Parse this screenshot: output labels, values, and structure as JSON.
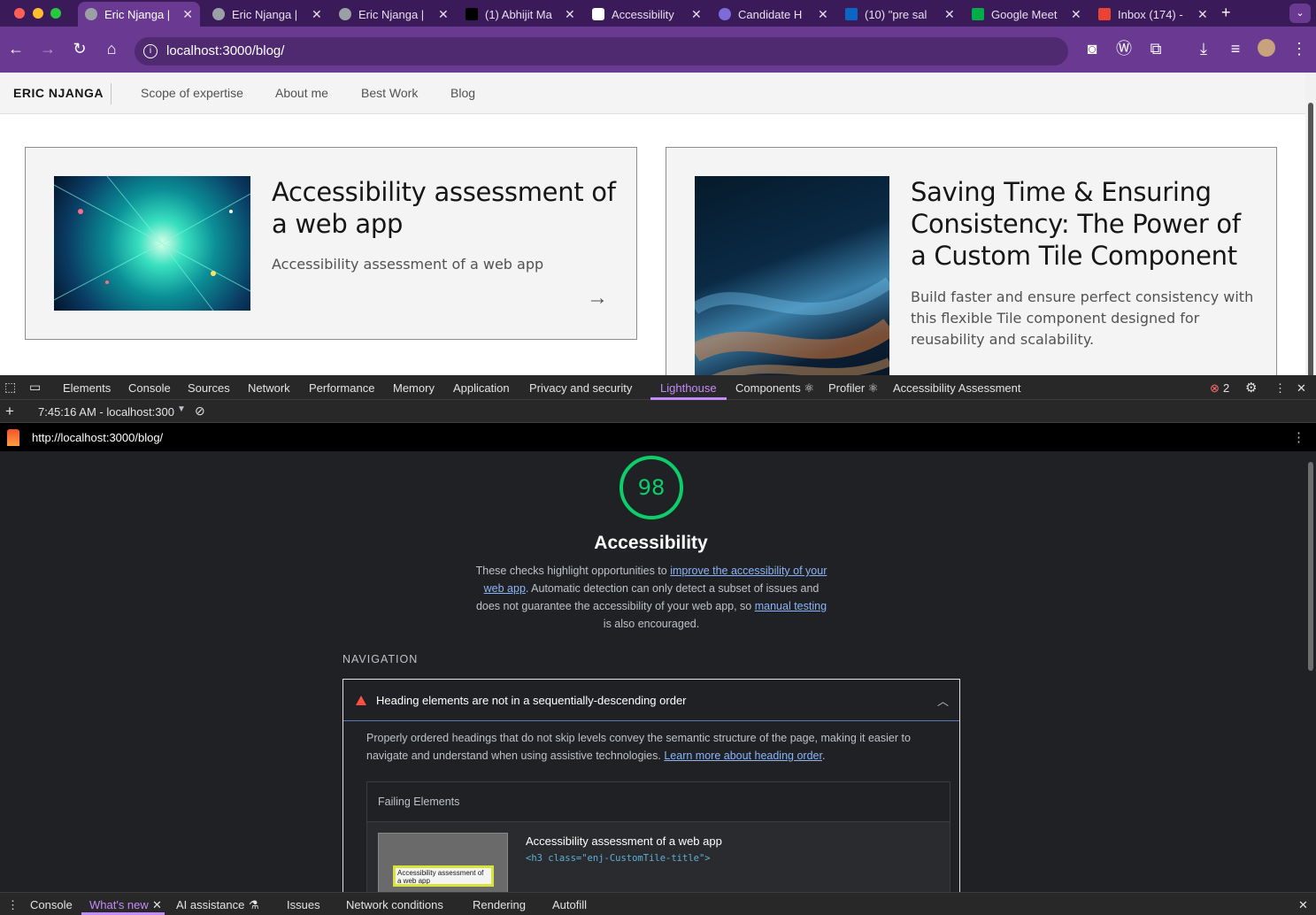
{
  "browser": {
    "tabs": [
      {
        "title": "Eric Njanga |",
        "active": true
      },
      {
        "title": "Eric Njanga |",
        "active": false
      },
      {
        "title": "Eric Njanga |",
        "active": false
      },
      {
        "title": "(1) Abhijit Ma",
        "active": false
      },
      {
        "title": "Accessibility",
        "active": false
      },
      {
        "title": "Candidate H",
        "active": false
      },
      {
        "title": "(10) \"pre sal",
        "active": false
      },
      {
        "title": "Google Meet",
        "active": false
      },
      {
        "title": "Inbox (174) -",
        "active": false
      }
    ],
    "url": "localhost:3000/blog/",
    "colors": {
      "frame": "#3b1a5a",
      "toolbar": "#6a3a92"
    }
  },
  "site": {
    "brand": "ERIC NJANGA",
    "nav": [
      "Scope of expertise",
      "About me",
      "Best Work",
      "Blog"
    ],
    "cards": [
      {
        "title": "Accessibility assessment of a web app",
        "description": "Accessibility assessment of a web app",
        "arrow": "→"
      },
      {
        "title": "Saving Time & Ensuring Consistency: The Power of a Custom Tile Component",
        "description": "Build faster and ensure perfect consistency with this flexible Tile component designed for reusability and scalability.",
        "arrow": "→"
      }
    ]
  },
  "devtools": {
    "tabs": [
      "Elements",
      "Console",
      "Sources",
      "Network",
      "Performance",
      "Memory",
      "Application",
      "Privacy and security",
      "Lighthouse",
      "Components ⚛",
      "Profiler ⚛",
      "Accessibility Assessment"
    ],
    "active_tab": "Lighthouse",
    "error_count": "2",
    "report_selector": "7:45:16 AM - localhost:300",
    "report_url": "http://localhost:3000/blog/"
  },
  "lighthouse": {
    "score": "98",
    "score_color": "#0cce6b",
    "category_title": "Accessibility",
    "description": {
      "part1": "These checks highlight opportunities to ",
      "link1": "improve the accessibility of your web app",
      "part2": ". Automatic detection can only detect a subset of issues and does not guarantee the accessibility of your web app, so ",
      "link2": "manual testing",
      "part3": " is also encouraged."
    },
    "group_title": "NAVIGATION",
    "audit": {
      "title": "Heading elements are not in a sequentially-descending order",
      "description": "Properly ordered headings that do not skip levels convey the semantic structure of the page, making it easier to navigate and understand when using assistive technologies. ",
      "link": "Learn more about heading order",
      "description_end": ".",
      "table_header": "Failing Elements",
      "node_label": "Accessibility assessment of a web app",
      "snippet": "<h3 class=\"enj-CustomTile-title\">",
      "thumb_text": "Accessibility assessment of a web app"
    }
  },
  "drawer": {
    "tabs": [
      "Console",
      "What's new",
      "AI assistance",
      "Issues",
      "Network conditions",
      "Rendering",
      "Autofill"
    ],
    "active_tab": "What's new"
  }
}
